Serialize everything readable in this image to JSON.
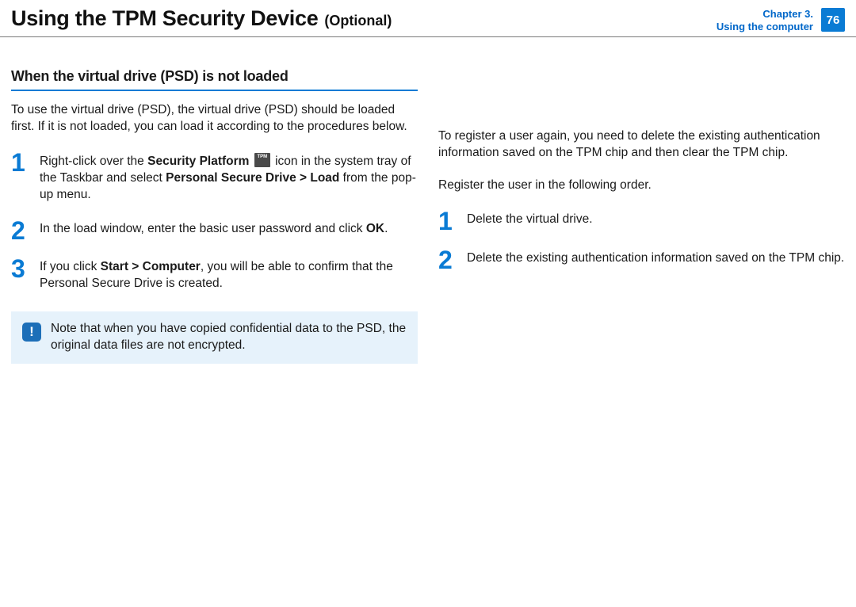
{
  "header": {
    "title": "Using the TPM Security Device",
    "suffix": "(Optional)",
    "chapter_line1": "Chapter 3.",
    "chapter_line2": "Using the computer",
    "page": "76"
  },
  "left": {
    "section_title": "When the virtual drive (PSD) is not loaded",
    "intro": "To use the virtual drive (PSD), the virtual drive (PSD) should be loaded first. If it is not loaded, you can load it according to the procedures below.",
    "steps": [
      {
        "num": "1",
        "pre": "Right-click over the ",
        "b1": "Security Platform",
        "mid1": " icon in the system tray of the Taskbar and select ",
        "b2": "Personal Secure Drive > Load",
        "post": " from the pop-up menu.",
        "has_icon": true
      },
      {
        "num": "2",
        "pre": "In the load window, enter the basic user password and click ",
        "b1": "OK",
        "post": ".",
        "has_icon": false
      },
      {
        "num": "3",
        "pre": "If you click ",
        "b1": "Start > Computer",
        "post": ", you will be able to confirm that the Personal Secure Drive is created.",
        "has_icon": false
      }
    ],
    "note_icon": "!",
    "note": "Note that when you have copied confidential data to the PSD, the original data files are not encrypted."
  },
  "right": {
    "intro1": "To register a user again, you need to delete the existing authentication information saved on the TPM chip and then clear the TPM chip.",
    "intro2": "Register the user in the following order.",
    "steps": [
      {
        "num": "1",
        "text": "Delete the virtual drive."
      },
      {
        "num": "2",
        "text": "Delete the existing authentication information saved on the TPM chip."
      }
    ]
  }
}
